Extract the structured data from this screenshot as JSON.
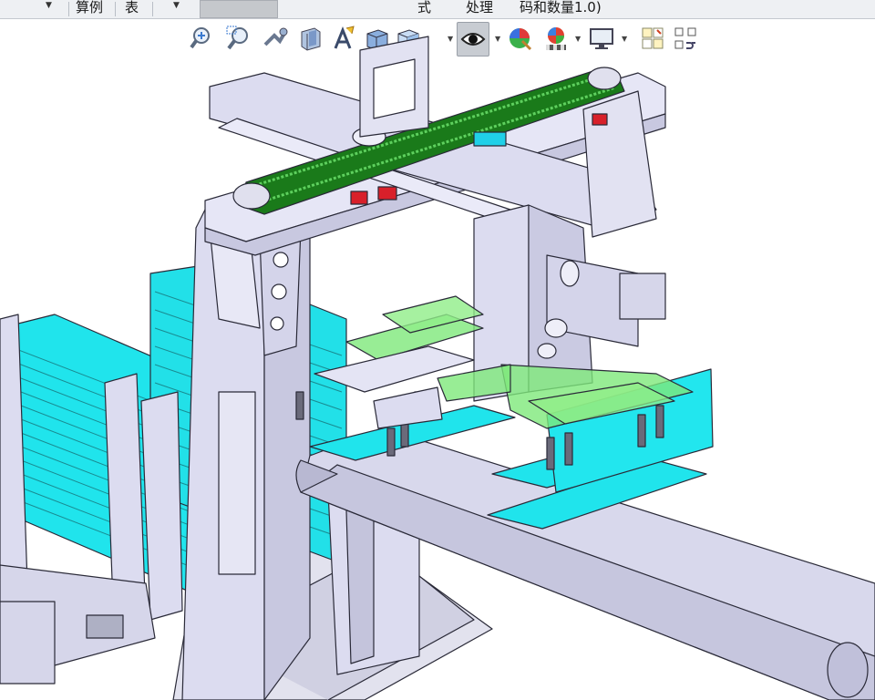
{
  "menubar": {
    "item_suanli": "算例",
    "item_biao": "表",
    "item_shi": "式",
    "item_chuli": "处理",
    "item_title": "码和数量1.0)"
  },
  "view_toolbar": {
    "icons": [
      "zoom-to-fit-icon",
      "zoom-to-area-icon",
      "previous-view-icon",
      "section-view-icon",
      "dynamic-annotation-icon",
      "view-orientation-icon",
      "display-style-icon",
      "hide-show-items-icon",
      "edit-appearance-icon",
      "apply-scene-icon",
      "view-settings-icon",
      "split-window-icon",
      "link-views-icon"
    ]
  },
  "colors": {
    "toolbar_bg": "#eef0f3",
    "frame": "#dcdcf0",
    "edges": "#2a2a38",
    "cyan_panel": "#20e4ec",
    "belt_green": "#1a7a1a",
    "gripper_green": "#7ee87a",
    "red_part": "#d8202a"
  }
}
